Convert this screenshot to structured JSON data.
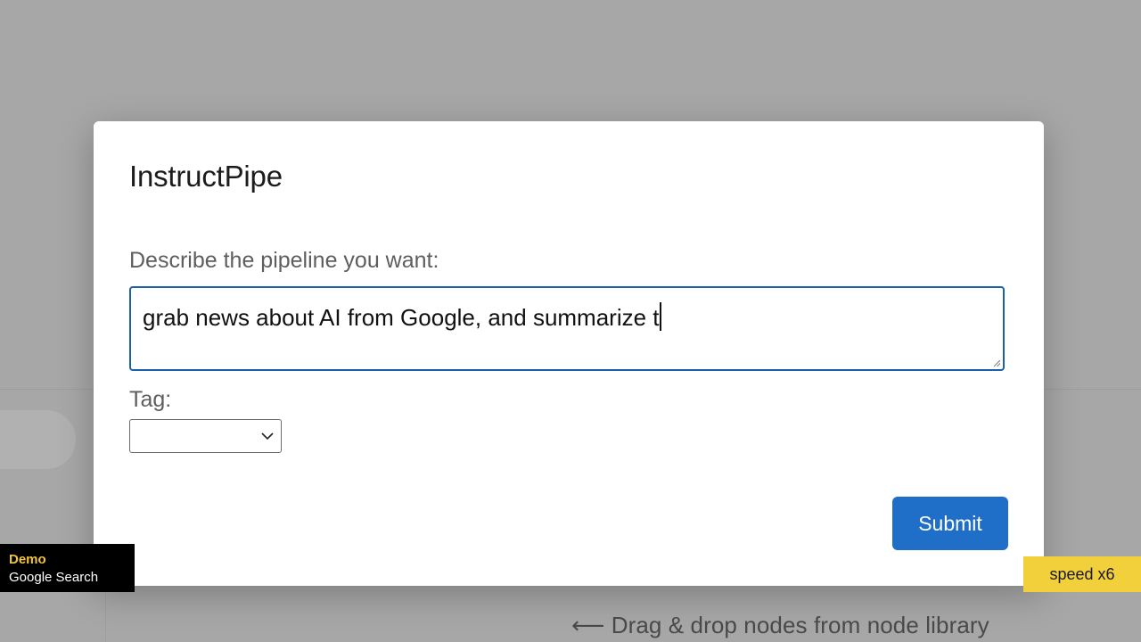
{
  "background": {
    "hint_text": "⟵ Drag & drop nodes from node library"
  },
  "modal": {
    "title": "InstructPipe",
    "prompt_label": "Describe the pipeline you want:",
    "prompt_value": "grab news about AI from Google, and summarize t",
    "tag_label": "Tag:",
    "tag_selected": "",
    "submit_label": "Submit"
  },
  "overlay": {
    "demo_title": "Demo",
    "demo_subtitle": "Google Search",
    "speed_label": "speed x6"
  },
  "colors": {
    "accent": "#1f6fc8",
    "input_focus_border": "#1c5fae",
    "demo_title": "#f2c43b",
    "speed_badge": "#f2d03b"
  },
  "icons": {
    "tag_dropdown": "chevron-down-icon",
    "textarea_resize": "resize-grip-icon"
  }
}
